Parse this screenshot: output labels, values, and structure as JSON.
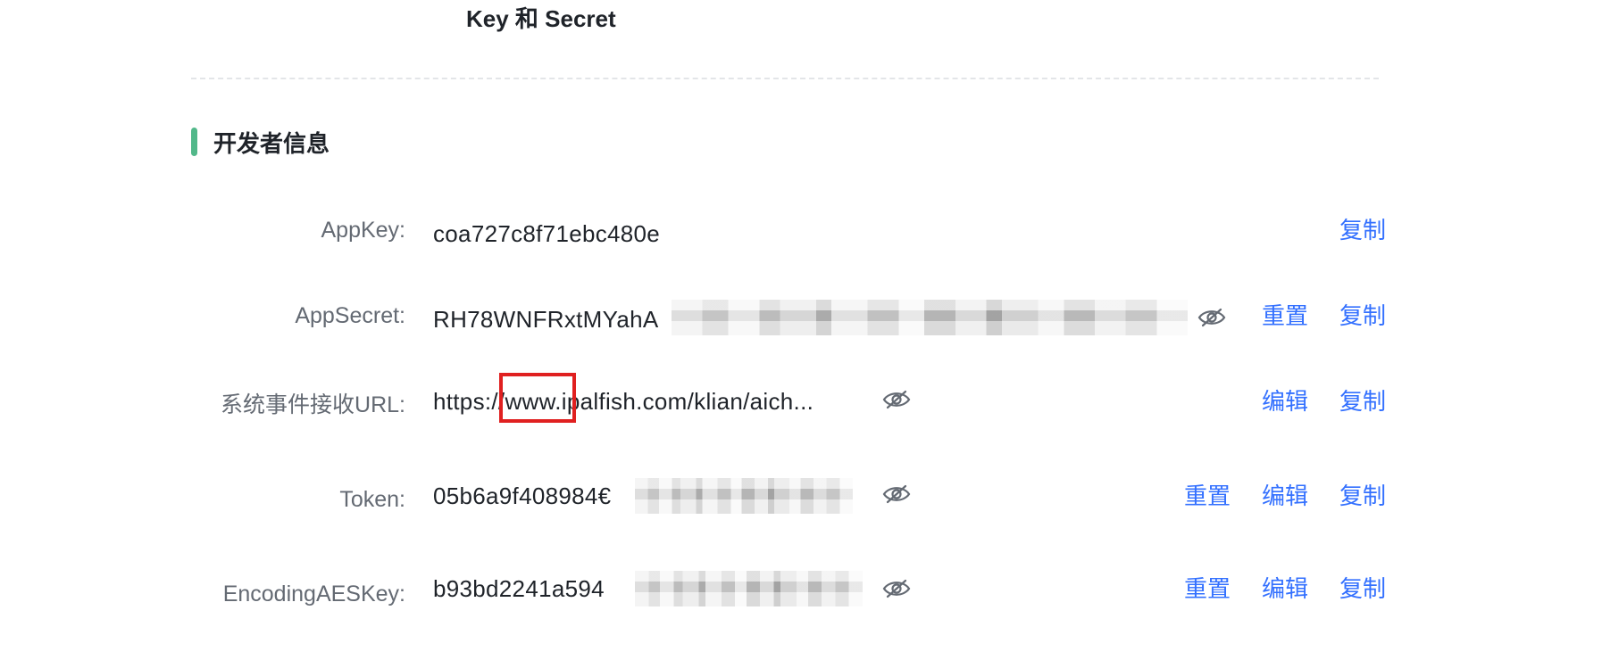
{
  "header": {
    "title": "Key 和 Secret"
  },
  "section": {
    "title": "开发者信息"
  },
  "rows": [
    {
      "label": "AppKey:",
      "value": "coa727c8f71ebc480e",
      "masked": false,
      "actions": [
        "复制"
      ]
    },
    {
      "label": "AppSecret:",
      "value": "RH78WNFRxtMYahA",
      "masked": true,
      "eye_icon": "eye-off-icon",
      "actions": [
        "重置",
        "复制"
      ]
    },
    {
      "label": "系统事件接收URL:",
      "value": "https://www.ipalfish.com/klian/aich...",
      "masked": false,
      "eye_icon": "eye-off-icon",
      "actions": [
        "编辑",
        "复制"
      ]
    },
    {
      "label": "Token:",
      "value": "05b6a9f408984€",
      "masked": true,
      "eye_icon": "eye-off-icon",
      "actions": [
        "重置",
        "编辑",
        "复制"
      ]
    },
    {
      "label": "EncodingAESKey:",
      "value": "b93bd2241a594",
      "masked": true,
      "eye_icon": "eye-off-icon",
      "actions": [
        "重置",
        "编辑",
        "复制"
      ]
    }
  ],
  "colors": {
    "accent": "#3370ff",
    "section_bar": "#52b88a",
    "highlight": "#e02020",
    "label": "#646a73"
  }
}
